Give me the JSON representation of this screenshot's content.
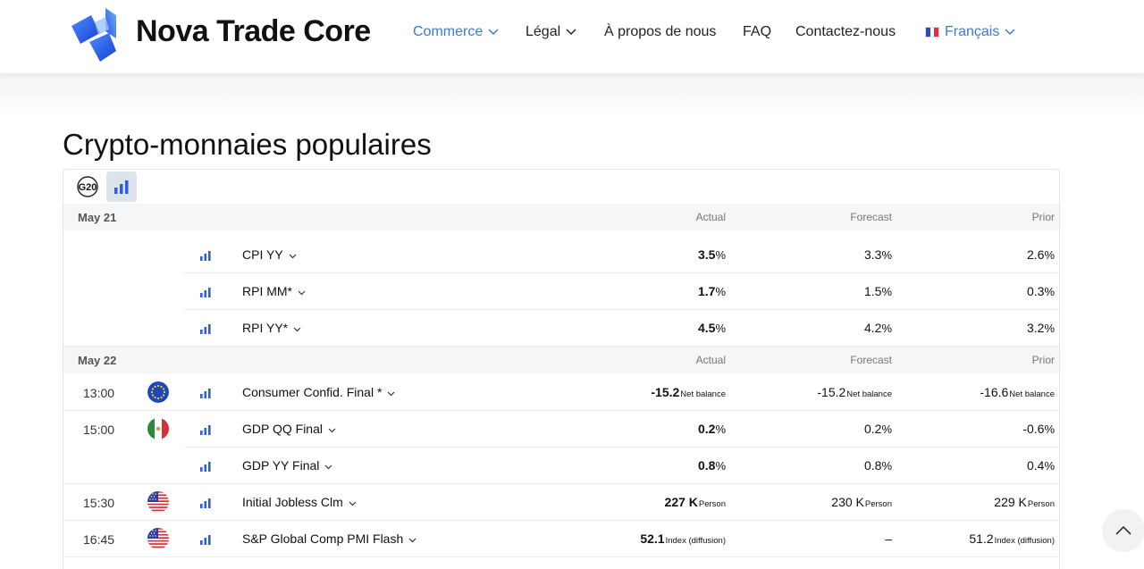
{
  "header": {
    "brand": "Nova Trade Core",
    "nav": [
      {
        "label": "Commerce",
        "dropdown": true,
        "active": true
      },
      {
        "label": "Légal",
        "dropdown": true,
        "active": false
      },
      {
        "label": "À propos de nous",
        "dropdown": false,
        "active": false
      },
      {
        "label": "FAQ",
        "dropdown": false,
        "active": false
      },
      {
        "label": "Contactez-nous",
        "dropdown": false,
        "active": false
      },
      {
        "label": "Français",
        "dropdown": true,
        "active": true,
        "icon": "flag-fr-icon"
      }
    ]
  },
  "page": {
    "title": "Crypto-monnaies populaires"
  },
  "toolbar": {
    "g20_label": "G20",
    "chart_icon": "bar-chart-icon"
  },
  "headers": {
    "actual": "Actual",
    "forecast": "Forecast",
    "prior": "Prior"
  },
  "groups": [
    {
      "date": "May 21",
      "rows": [
        {
          "time": "",
          "flag": "",
          "name": "CPI YY",
          "actual": "3.5",
          "actual_unit": "%",
          "forecast": "3.3",
          "forecast_unit": "%",
          "prior": "2.6",
          "prior_unit": "%"
        },
        {
          "time": "",
          "flag": "",
          "name": "RPI MM*",
          "actual": "1.7",
          "actual_unit": "%",
          "forecast": "1.5",
          "forecast_unit": "%",
          "prior": "0.3",
          "prior_unit": "%"
        },
        {
          "time": "",
          "flag": "",
          "name": "RPI YY*",
          "actual": "4.5",
          "actual_unit": "%",
          "forecast": "4.2",
          "forecast_unit": "%",
          "prior": "3.2",
          "prior_unit": "%"
        }
      ]
    },
    {
      "date": "May 22",
      "rows": [
        {
          "time": "13:00",
          "flag": "eu",
          "name": "Consumer Confid. Final *",
          "actual": "-15.2",
          "actual_unit": "Net balance",
          "forecast": "-15.2",
          "forecast_unit": "Net balance",
          "prior": "-16.6",
          "prior_unit": "Net balance"
        },
        {
          "time": "15:00",
          "flag": "mx",
          "name": "GDP QQ Final",
          "actual": "0.2",
          "actual_unit": "%",
          "forecast": "0.2",
          "forecast_unit": "%",
          "prior": "-0.6",
          "prior_unit": "%"
        },
        {
          "time": "",
          "flag": "",
          "name": "GDP YY Final",
          "actual": "0.8",
          "actual_unit": "%",
          "forecast": "0.8",
          "forecast_unit": "%",
          "prior": "0.4",
          "prior_unit": "%"
        },
        {
          "time": "15:30",
          "flag": "us",
          "name": "Initial Jobless Clm",
          "actual": "227 K",
          "actual_unit": "Person",
          "forecast": "230 K",
          "forecast_unit": "Person",
          "prior": "229 K",
          "prior_unit": "Person"
        },
        {
          "time": "16:45",
          "flag": "us",
          "name": "S&P Global Comp PMI Flash",
          "actual": "52.1",
          "actual_unit": "Index (diffusion)",
          "forecast": "–",
          "forecast_unit": "",
          "prior": "51.2",
          "prior_unit": "Index (diffusion)"
        }
      ]
    }
  ],
  "colors": {
    "accent": "#3a7bd5",
    "bars": "#2f5fd6"
  },
  "scroll_top_icon": "chevron-up-icon"
}
